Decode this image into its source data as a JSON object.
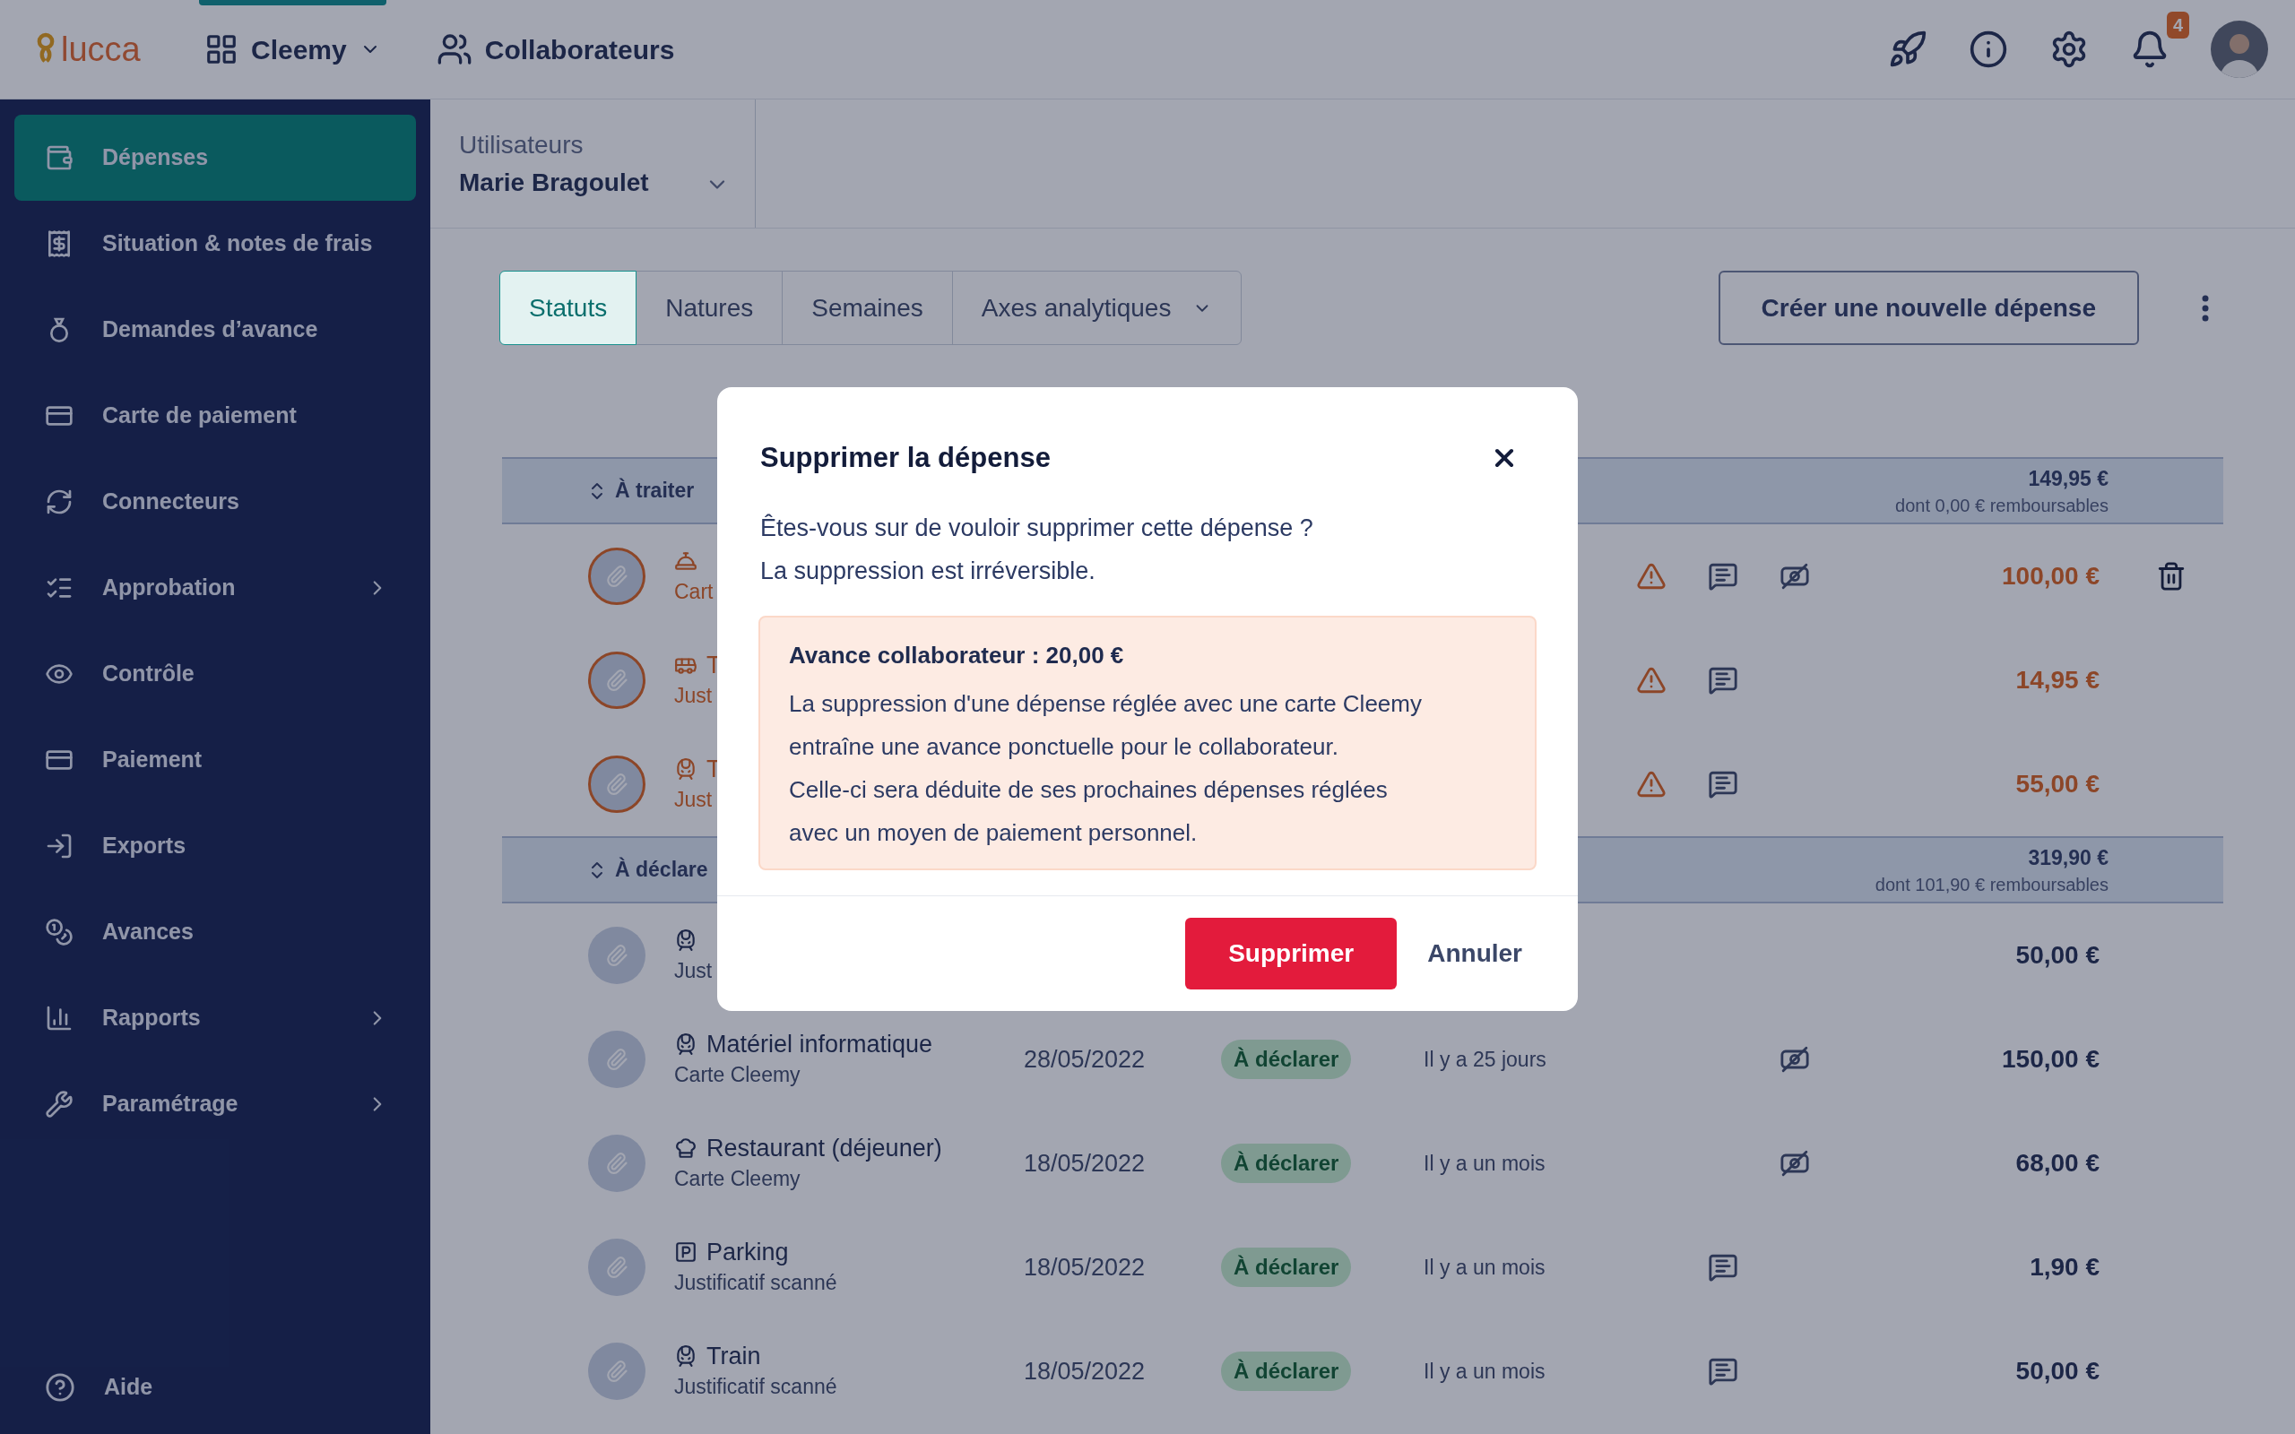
{
  "topbar": {
    "logo": "lucca",
    "app_menu": {
      "label": "Cleemy",
      "selected": true
    },
    "section": "Collaborateurs",
    "notifications": "4"
  },
  "sidebar": {
    "items": [
      {
        "label": "Dépenses",
        "selected": true,
        "expandable": false
      },
      {
        "label": "Situation & notes de frais",
        "selected": false,
        "expandable": false
      },
      {
        "label": "Demandes d’avance",
        "selected": false,
        "expandable": false
      },
      {
        "label": "Carte de paiement",
        "selected": false,
        "expandable": false
      },
      {
        "label": "Connecteurs",
        "selected": false,
        "expandable": false
      },
      {
        "label": "Approbation",
        "selected": false,
        "expandable": true
      },
      {
        "label": "Contrôle",
        "selected": false,
        "expandable": false
      },
      {
        "label": "Paiement",
        "selected": false,
        "expandable": false
      },
      {
        "label": "Exports",
        "selected": false,
        "expandable": false
      },
      {
        "label": "Avances",
        "selected": false,
        "expandable": false
      },
      {
        "label": "Rapports",
        "selected": false,
        "expandable": true
      },
      {
        "label": "Paramétrage",
        "selected": false,
        "expandable": true
      }
    ],
    "help": "Aide"
  },
  "user_selector": {
    "label": "Utilisateurs",
    "value": "Marie Bragoulet"
  },
  "tabs": [
    {
      "label": "Statuts",
      "selected": true,
      "dropdown": false
    },
    {
      "label": "Natures",
      "selected": false,
      "dropdown": false
    },
    {
      "label": "Semaines",
      "selected": false,
      "dropdown": false
    },
    {
      "label": "Axes analytiques",
      "selected": false,
      "dropdown": true
    }
  ],
  "create_button": "Créer une nouvelle dépense",
  "groups": [
    {
      "label": "À traiter",
      "total": "149,95 €",
      "refundable": "dont 0,00 € remboursables",
      "rows": [
        {
          "kind": "cloche",
          "subtitle": "Cart",
          "attention": true,
          "alert": true,
          "comment": true,
          "hidden_receipt": true,
          "amount": "100,00 €",
          "deletable": true
        },
        {
          "kind": "bus",
          "title": "T",
          "subtitle": "Just",
          "attention": true,
          "alert": true,
          "comment": true,
          "hidden_receipt": false,
          "amount": "14,95 €",
          "deletable": false
        },
        {
          "kind": "train",
          "title": "T",
          "subtitle": "Just",
          "attention": true,
          "alert": true,
          "comment": true,
          "hidden_receipt": false,
          "amount": "55,00 €",
          "deletable": false
        }
      ]
    },
    {
      "label": "À déclare",
      "total": "319,90 €",
      "refundable": "dont 101,90 € remboursables",
      "rows": [
        {
          "kind": "train",
          "subtitle": "Just",
          "attention": false,
          "alert": false,
          "comment": false,
          "hidden_receipt": false,
          "amount": "50,00 €",
          "deletable": false
        },
        {
          "kind": "train",
          "title": "Matériel informatique",
          "subtitle": "Carte Cleemy",
          "date": "28/05/2022",
          "status": "À déclarer",
          "age": "Il y a 25 jours",
          "attention": false,
          "alert": false,
          "comment": false,
          "hidden_receipt": true,
          "amount": "150,00 €",
          "deletable": false
        },
        {
          "kind": "chef",
          "title": "Restaurant (déjeuner)",
          "subtitle": "Carte Cleemy",
          "date": "18/05/2022",
          "status": "À déclarer",
          "age": "Il y a un mois",
          "attention": false,
          "alert": false,
          "comment": false,
          "hidden_receipt": true,
          "amount": "68,00 €",
          "deletable": false
        },
        {
          "kind": "parking",
          "title": "Parking",
          "subtitle": "Justificatif scanné",
          "date": "18/05/2022",
          "status": "À déclarer",
          "age": "Il y a un mois",
          "attention": false,
          "alert": false,
          "comment": true,
          "hidden_receipt": false,
          "amount": "1,90 €",
          "deletable": false
        },
        {
          "kind": "train",
          "title": "Train",
          "subtitle": "Justificatif scanné",
          "date": "18/05/2022",
          "status": "À déclarer",
          "age": "Il y a un mois",
          "attention": false,
          "alert": false,
          "comment": true,
          "hidden_receipt": false,
          "amount": "50,00 €",
          "deletable": false
        }
      ]
    }
  ],
  "dialog": {
    "title": "Supprimer la dépense",
    "message": [
      "Êtes-vous sur de vouloir supprimer cette dépense ?",
      "La suppression est irréversible."
    ],
    "callout": {
      "title": "Avance collaborateur : 20,00 €",
      "lines": [
        "La suppression d'une dépense réglée avec une carte Cleemy",
        "entraîne une avance ponctuelle pour le collaborateur.",
        "Celle-ci sera déduite de ses prochaines dépenses réglées",
        "avec un moyen de paiement personnel."
      ]
    },
    "confirm": "Supprimer",
    "cancel": "Annuler"
  }
}
